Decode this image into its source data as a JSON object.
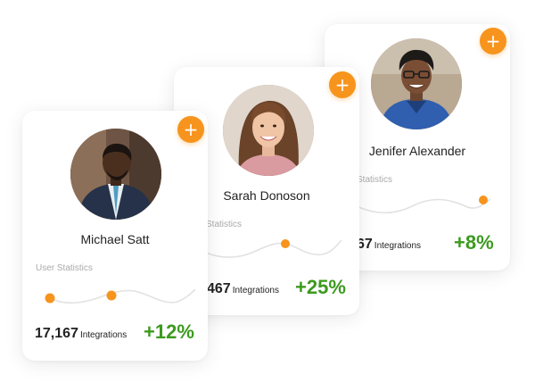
{
  "colors": {
    "accent": "#f7941d",
    "positive": "#3c9a1e",
    "text": "#222222",
    "muted": "#aaaaaa"
  },
  "cards": [
    {
      "name": "Michael Satt",
      "add_icon": "plus",
      "stats_label": "User Statistics",
      "integrations_value": "17,167",
      "integrations_label": "Integrations",
      "change": "+12%"
    },
    {
      "name": "Sarah Donoson",
      "add_icon": "plus",
      "stats_label": "Statistics",
      "integrations_value": "467",
      "integrations_label": "Integrations",
      "change": "+25%"
    },
    {
      "name": "Jenifer Alexander",
      "add_icon": "plus",
      "stats_label": "Statistics",
      "integrations_value": "67",
      "integrations_label": "Integrations",
      "change": "+8%"
    }
  ]
}
